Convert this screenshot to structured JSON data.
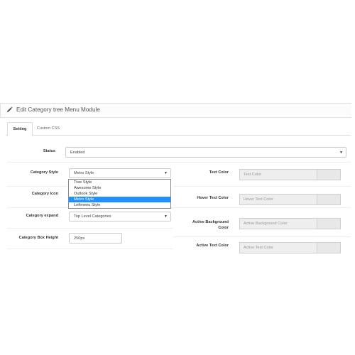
{
  "panel": {
    "title": "Edit Category tree Menu Module"
  },
  "tabs": [
    {
      "label": "Setting",
      "active": true
    },
    {
      "label": "Custom CSS",
      "active": false
    }
  ],
  "status": {
    "label": "Status",
    "value": "Enabled"
  },
  "category_style": {
    "label": "Category Style",
    "value": "Metro Style",
    "options": [
      "Tree Style",
      "Awesome Style",
      "Outlook Style",
      "Metro Style",
      "Leftmenu Style"
    ],
    "highlighted": "Metro Style"
  },
  "category_icon": {
    "label": "Category Icon"
  },
  "category_expand": {
    "label": "Category expand",
    "value": "Top Level Categories"
  },
  "category_box_height": {
    "label": "Category Box Height",
    "value": "250px"
  },
  "colors": {
    "text_color": {
      "label": "Text Color",
      "placeholder": "Text Color"
    },
    "hover_text_color": {
      "label": "Hover Text Color",
      "placeholder": "Hover Text Color"
    },
    "active_background_color": {
      "label": "Active Background Color",
      "label_line1": "Active Background",
      "label_line2": "Color",
      "placeholder": "Active Background Color"
    },
    "active_text_color": {
      "label": "Active Text Color",
      "placeholder": "Active Text Color"
    }
  },
  "icons": {
    "title_icon": "pencil-icon",
    "caret_icon": "caret-down-icon"
  },
  "theme": {
    "highlight": "#1e90ff",
    "border": "#cccccc"
  }
}
